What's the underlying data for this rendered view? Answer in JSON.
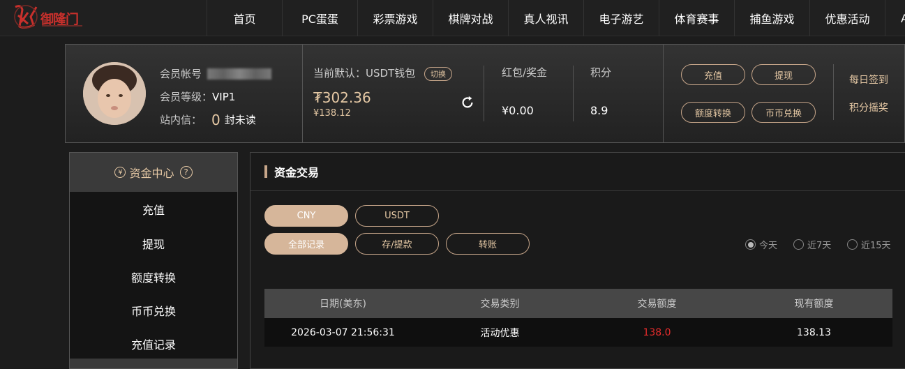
{
  "header": {
    "logo_text": "御隆门",
    "nav": [
      "首页",
      "PC蛋蛋",
      "彩票游戏",
      "棋牌对战",
      "真人视讯",
      "电子游艺",
      "体育赛事",
      "捕鱼游戏",
      "优惠活动",
      "A"
    ]
  },
  "member": {
    "account_label": "会员帐号",
    "level_label": "会员等级：",
    "level_value": "VIP1",
    "mail_label": "站内信：",
    "unread_count": "0",
    "unread_suffix": "封未读"
  },
  "wallet": {
    "default_label": "当前默认：USDT钱包",
    "switch_label": "切换",
    "balance_main": "₮302.36",
    "balance_cny": "¥138.12",
    "redpacket_label": "红包/奖金",
    "redpacket_value": "¥0.00",
    "points_label": "积分",
    "points_value": "8.9"
  },
  "actions": {
    "deposit": "充值",
    "withdraw": "提现",
    "transfer": "额度转换",
    "exchange": "币币兑换",
    "daily_signin": "每日签到",
    "points_lottery": "积分摇奖"
  },
  "sidebar": {
    "title": "资金中心",
    "items": [
      "充值",
      "提现",
      "额度转换",
      "币币兑换",
      "充值记录"
    ]
  },
  "main": {
    "title": "资金交易",
    "currency_tabs": [
      "CNY",
      "USDT"
    ],
    "record_tabs": [
      "全部记录",
      "存/提款",
      "转账"
    ],
    "ranges": [
      "今天",
      "近7天",
      "近15天"
    ],
    "table_headers": [
      "日期(美东)",
      "交易类别",
      "交易额度",
      "现有额度"
    ],
    "rows": [
      [
        "2026-03-07 21:56:31",
        "活动优惠",
        "138.0",
        "138.13"
      ]
    ]
  },
  "colors": {
    "accent": "#e6c9a5",
    "negative": "#e62c2c",
    "background": "#1c1c1c"
  }
}
